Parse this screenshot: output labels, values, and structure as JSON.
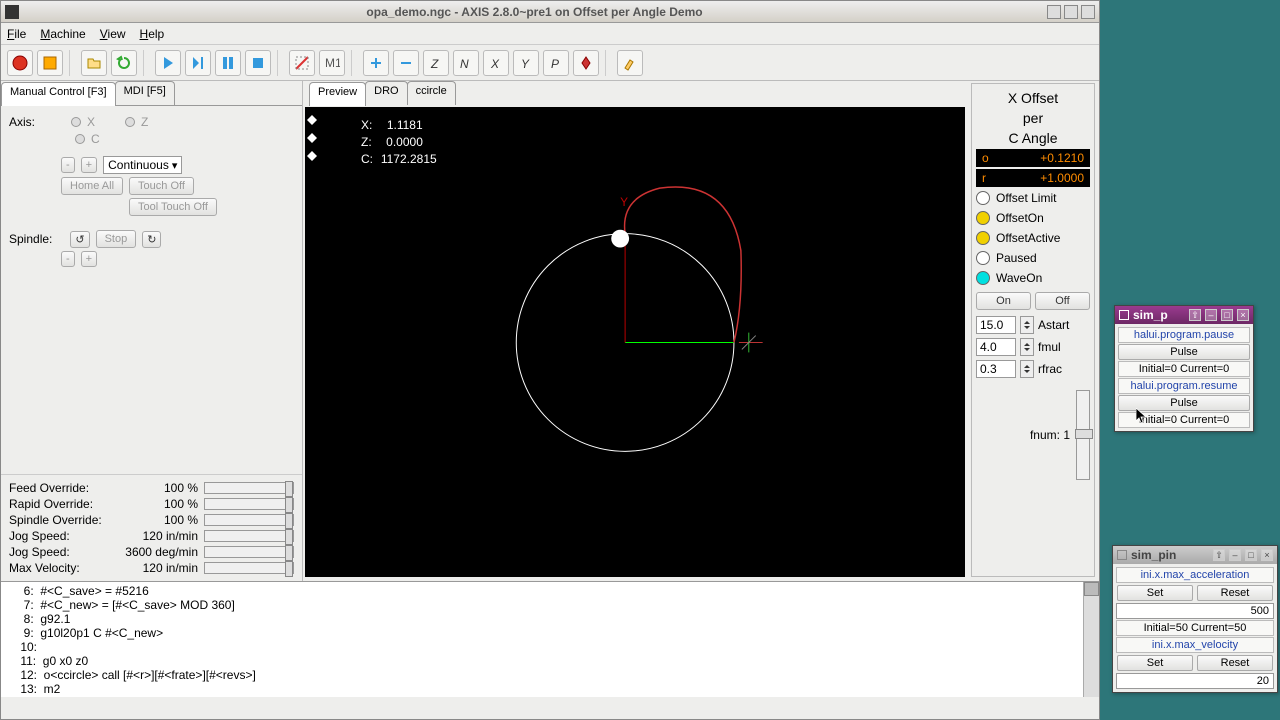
{
  "window": {
    "title": "opa_demo.ngc - AXIS 2.8.0~pre1 on Offset per Angle Demo"
  },
  "menu": {
    "file": "File",
    "machine": "Machine",
    "view": "View",
    "help": "Help"
  },
  "left_tabs": {
    "manual": "Manual Control [F3]",
    "mdi": "MDI [F5]"
  },
  "manual": {
    "axis_label": "Axis:",
    "axis_x": "X",
    "axis_z": "Z",
    "axis_c": "C",
    "minus": "-",
    "plus": "+",
    "mode": "Continuous",
    "home_all": "Home All",
    "touch_off": "Touch Off",
    "tool_touch_off": "Tool Touch Off",
    "spindle_label": "Spindle:",
    "stop": "Stop"
  },
  "overrides": [
    {
      "label": "Feed Override:",
      "value": "100 %"
    },
    {
      "label": "Rapid Override:",
      "value": "100 %"
    },
    {
      "label": "Spindle Override:",
      "value": "100 %"
    },
    {
      "label": "Jog Speed:",
      "value": "120 in/min"
    },
    {
      "label": "Jog Speed:",
      "value": "3600 deg/min"
    },
    {
      "label": "Max Velocity:",
      "value": "120 in/min"
    }
  ],
  "center_tabs": {
    "preview": "Preview",
    "dro": "DRO",
    "ccircle": "ccircle"
  },
  "coords": {
    "x_label": "X:",
    "x_val": "  1.1181",
    "z_label": "Z:",
    "z_val": "  0.0000",
    "c_label": "C:",
    "c_val": "1172.2815"
  },
  "right": {
    "title1": "X Offset",
    "title2": "per",
    "title3": "C Angle",
    "o_key": "o",
    "o_val": "+0.1210",
    "r_key": "r",
    "r_val": "+1.0000",
    "leds": [
      {
        "color": "#fff",
        "label": "Offset Limit"
      },
      {
        "color": "#f0d000",
        "label": "OffsetOn"
      },
      {
        "color": "#f0d000",
        "label": "OffsetActive"
      },
      {
        "color": "#fff",
        "label": "Paused"
      },
      {
        "color": "#00e0e0",
        "label": "WaveOn"
      }
    ],
    "on": "On",
    "off": "Off",
    "astart_v": "15.0",
    "astart_l": "Astart",
    "fmul_v": "4.0",
    "fmul_l": "fmul",
    "rfrac_v": "0.3",
    "rfrac_l": "rfrac",
    "fnum_l": "fnum:",
    "fnum_v": "1"
  },
  "gcode": [
    "     6:  #<C_save> = #5216",
    "     7:  #<C_new> = [#<C_save> MOD 360]",
    "     8:  g92.1",
    "     9:  g10l20p1 C #<C_new>",
    "    10:  ",
    "    11:  g0 x0 z0",
    "    12:  o<ccircle> call [#<r>][#<frate>][#<revs>]",
    "    13:  m2"
  ],
  "simp1": {
    "title": "sim_p",
    "h1": "halui.program.pause",
    "p1": "Pulse",
    "s1": "Initial=0 Current=0",
    "h2": "halui.program.resume",
    "p2": "Pulse",
    "s2": "Initial=0 Current=0"
  },
  "simp2": {
    "title": "sim_pin",
    "h1": "ini.x.max_acceleration",
    "set1": "Set",
    "reset1": "Reset",
    "v1": "500",
    "s1": "Initial=50 Current=50",
    "h2": "ini.x.max_velocity",
    "set2": "Set",
    "reset2": "Reset",
    "v2": "20"
  }
}
